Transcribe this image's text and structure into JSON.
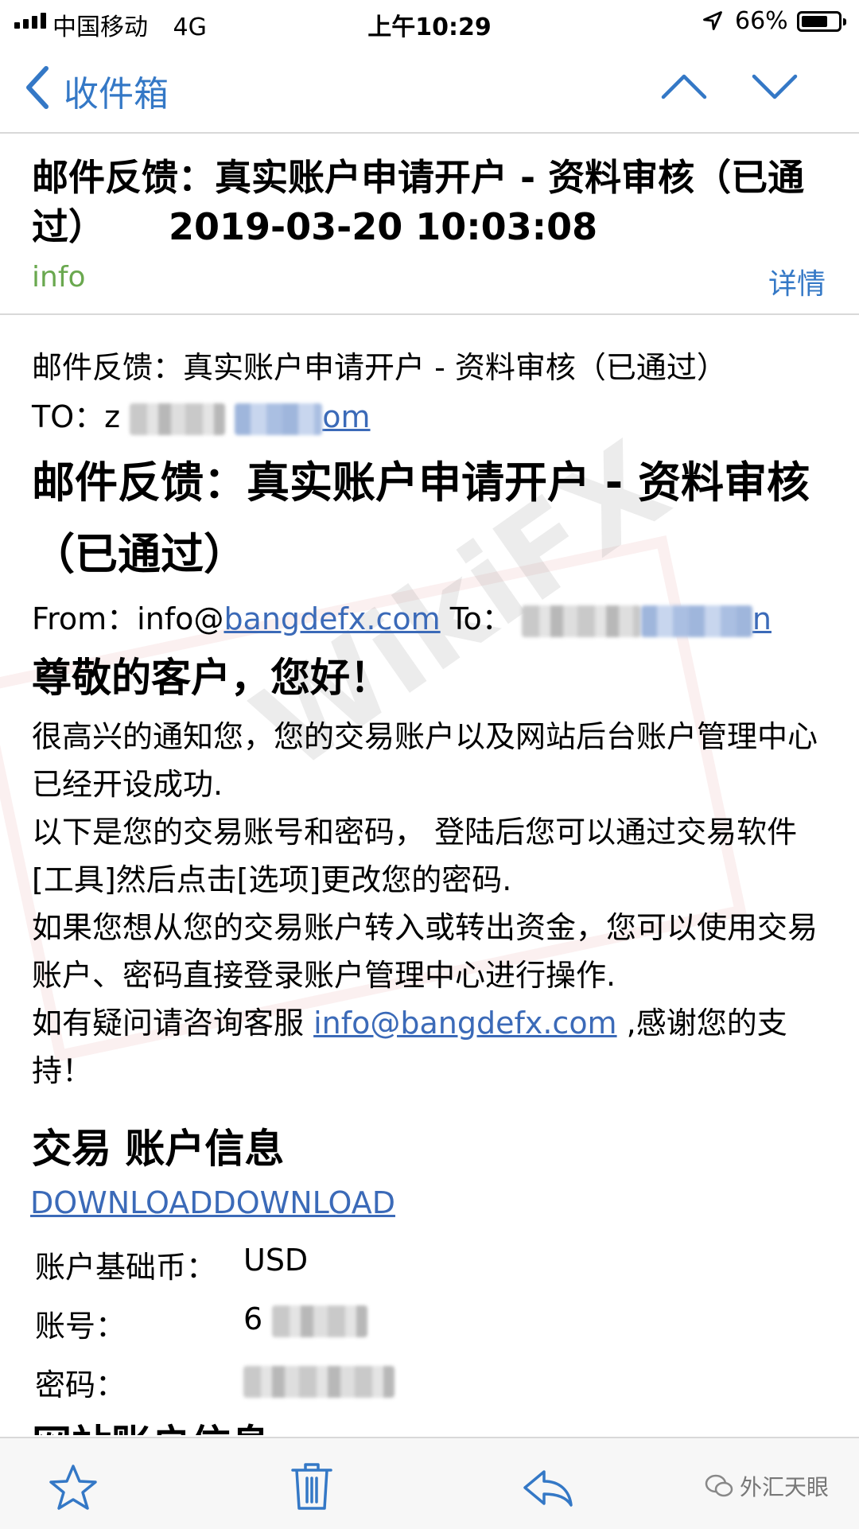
{
  "status_bar": {
    "carrier": "中国移动",
    "network": "4G",
    "time": "上午10:29",
    "battery": "66%"
  },
  "nav": {
    "back_label": "收件箱",
    "icons": {
      "back": "chevron-left-icon",
      "prev": "chevron-up-icon",
      "next": "chevron-down-icon"
    }
  },
  "header": {
    "subject": "邮件反馈：真实账户申请开户 - 资料审核（已通过）",
    "datetime": "2019-03-20 10:03:08",
    "sender": "info",
    "details_label": "详情"
  },
  "body": {
    "subject_line": "邮件反馈：真实账户申请开户 - 资料审核（已通过）",
    "to_label": "TO：",
    "to_visible_start": "z",
    "to_visible_end": "om",
    "title": "邮件反馈：真实账户申请开户 - 资料审核（已通过）",
    "from_label": "From：",
    "from_prefix": "info@",
    "from_link": "bangdefx.com",
    "to2_label": "To：",
    "to2_visible_end": "n",
    "greeting": "尊敬的客户，您好！",
    "p1": "很高兴的通知您，您的交易账户以及网站后台账户管理中心已经开设成功.",
    "p2": "以下是您的交易账号和密码， 登陆后您可以通过交易软件[工具]然后点击[选项]更改您的密码.",
    "p3": "如果您想从您的交易账户转入或转出资金，您可以使用交易账户、密码直接登录账户管理中心进行操作.",
    "p4_prefix": "如有疑问请咨询客服 ",
    "p4_link": "info@bangdefx.com",
    "p4_suffix": " ,感谢您的支持！",
    "section_title": "交易 账户信息",
    "download_link": "DOWNLOADDOWNLOAD",
    "account": {
      "base_currency_label": "账户基础币：",
      "base_currency": "USD",
      "number_label": "账号：",
      "number_visible": "6",
      "password_label": "密码："
    },
    "next_section_title": "网站账户信息"
  },
  "toolbar": {
    "icons": [
      "star-icon",
      "trash-icon",
      "reply-icon"
    ],
    "wechat_label": "外汇天眼"
  },
  "watermark": "WikiFX"
}
